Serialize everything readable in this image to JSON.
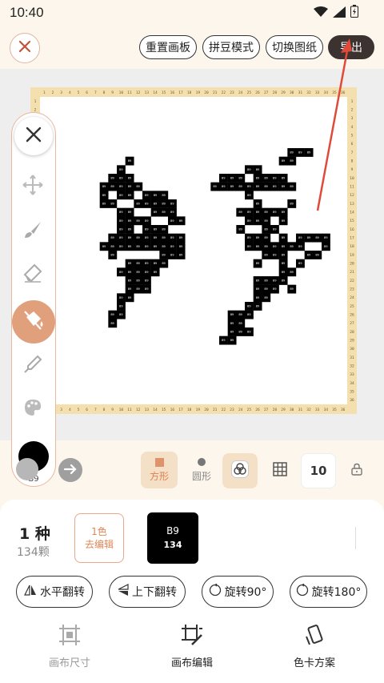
{
  "status_bar": {
    "time": "10:40"
  },
  "header": {
    "reset_label": "重置画板",
    "bead_mode_label": "拼豆模式",
    "switch_pattern_label": "切换图纸",
    "export_label": "导出"
  },
  "ruler": {
    "max": 36
  },
  "canvas": {
    "cell_code": "B9",
    "pattern_rows": [
      "....................................",
      "....................................",
      "....................................",
      "....................................",
      "....................................",
      "....................................",
      ".............................###....",
      "..........#.................##......",
      ".........#..............##..........",
      "........###..........###.####.......",
      ".......#####........##########......",
      ".......#.##.###.........#...........",
      ".......##..#####.........#...#......",
      ".........##..###.......######.......",
      ".........####..##.......###.#.......",
      ".........##.###........#..##........",
      "........#########.......###.#.####..",
      ".......##########.......#######..#..",
      "........#.....###.........###..##...",
      "..........#####..........#..#.#.....",
      ".........#####..............##......",
      "..........###............####.......",
      "..........###............###.#......",
      ".........##..............##.........",
      ".........#..............##..........",
      "........##............###...........",
      "........#.............##............",
      "......................###...........",
      ".....................##.............",
      "....................................",
      "....................................",
      "....................................",
      "....................................",
      "....................................",
      "....................................",
      "...................................."
    ]
  },
  "toolbar": {
    "close_icon": "close-icon",
    "tools": [
      "move-icon",
      "brush-icon",
      "eraser-icon",
      "fill-icon",
      "eyedropper-icon",
      "palette-icon"
    ],
    "active_tool": "fill-icon",
    "current_color_label": "B9",
    "current_color_hex": "#000000"
  },
  "shape": {
    "square_label": "方形",
    "circle_label": "圆形",
    "size_value": "10"
  },
  "panel": {
    "kind_count": "1 种",
    "bead_count": "134颗",
    "edit_line1": "1色",
    "edit_line2": "去编辑",
    "swatch_code": "B9",
    "swatch_count": "134",
    "flip_h": "水平翻转",
    "flip_v": "上下翻转",
    "rotate90": "旋转90°",
    "rotate180": "旋转180°"
  },
  "tabs": [
    {
      "label": "画布尺寸",
      "active": false
    },
    {
      "label": "画布编辑",
      "active": true
    },
    {
      "label": "色卡方案",
      "active": false
    }
  ],
  "colors": {
    "accent": "#e0a07c",
    "annotation_arrow": "#e04a3a",
    "board": "#f4dfae",
    "dark_button": "#3c3230"
  }
}
